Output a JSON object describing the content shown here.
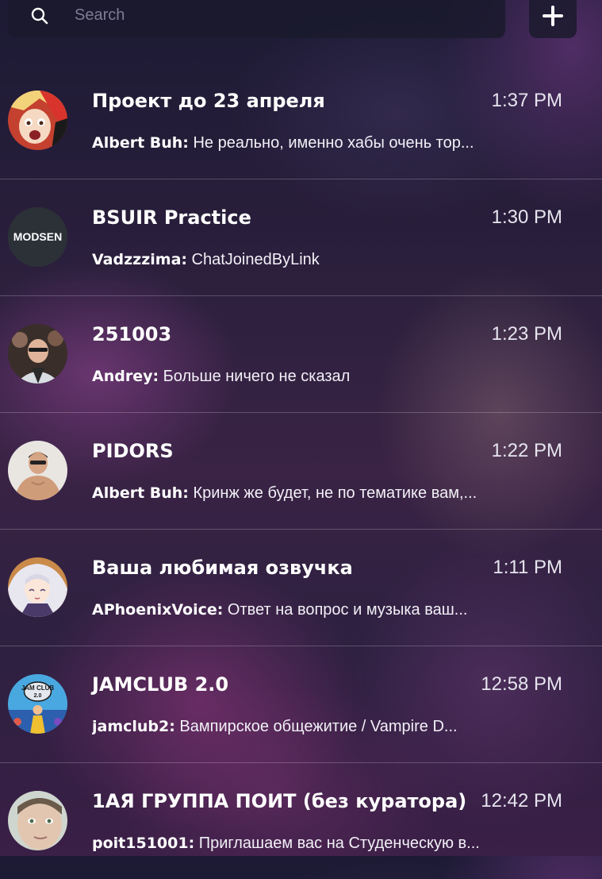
{
  "search": {
    "placeholder": "Search",
    "icon": "search-icon"
  },
  "add_button": {
    "icon": "plus-icon"
  },
  "colors": {
    "panel": "#1a1a2c",
    "text": "#ffffff",
    "muted": "#7c7c92",
    "divider": "#5a4d6a"
  },
  "chats": [
    {
      "title": "Проект до 23 апреля",
      "time": "1:37 PM",
      "sender": "Albert Buh:",
      "message": " Не реально, именно хабы очень тор...",
      "avatar": "anime-avatar"
    },
    {
      "title": "BSUIR Practice",
      "time": "1:30 PM",
      "sender": "Vadzzzima:",
      "message": " ChatJoinedByLink",
      "avatar": "modsen-logo-avatar",
      "avatar_text": "MODSEN"
    },
    {
      "title": "251003",
      "time": "1:23 PM",
      "sender": "Andrey:",
      "message": " Больше ничего не сказал",
      "avatar": "photo-avatar"
    },
    {
      "title": "PIDORS",
      "time": "1:22 PM",
      "sender": "Albert Buh:",
      "message": " Кринж же будет, не по тематике вам,...",
      "avatar": "photo-avatar"
    },
    {
      "title": "Ваша любимая озвучка",
      "time": "1:11 PM",
      "sender": "APhoenixVoice:",
      "message": " Ответ на вопрос и музыка ваш...",
      "avatar": "anime-avatar"
    },
    {
      "title": "JAMCLUB 2.0",
      "time": "12:58 PM",
      "sender": "jamclub2:",
      "message": " Вампирское общежитие / Vampire D...",
      "avatar": "jamclub-logo-avatar",
      "avatar_text_1": "JAM CLUB",
      "avatar_text_2": "2.0"
    },
    {
      "title": "1АЯ ГРУППА ПОИТ (без куратора)",
      "time": "12:42 PM",
      "sender": "poit151001:",
      "message": " Приглашаем вас на Студенческую в...",
      "avatar": "photo-avatar"
    }
  ]
}
